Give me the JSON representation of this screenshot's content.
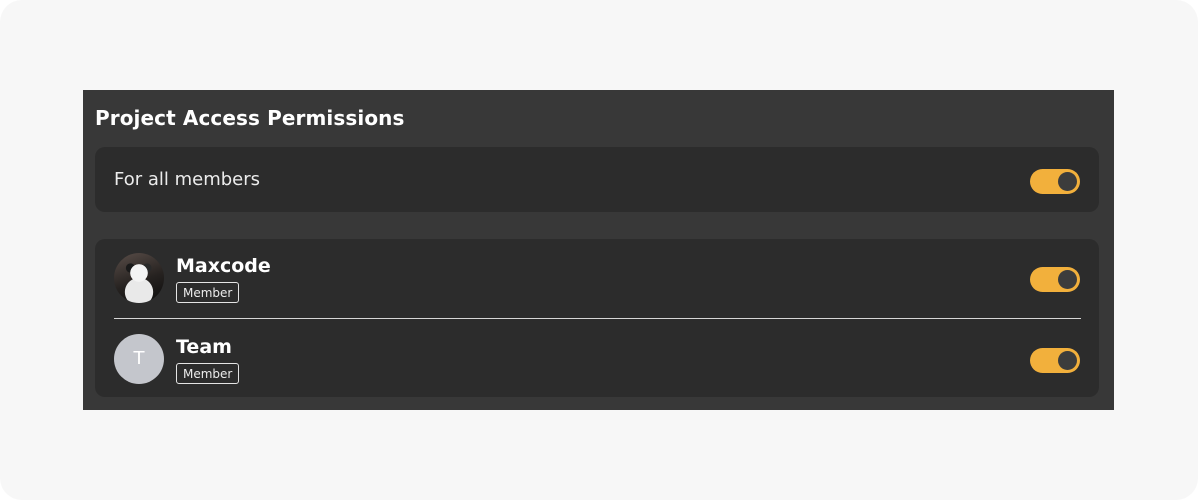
{
  "panel": {
    "title": "Project Access Permissions"
  },
  "all_members": {
    "label": "For all members",
    "toggle_on": true
  },
  "members": [
    {
      "name": "Maxcode",
      "role": "Member",
      "avatar": "photo",
      "toggle_on": true
    },
    {
      "name": "Team",
      "role": "Member",
      "avatar_initial": "T",
      "toggle_on": true
    }
  ],
  "colors": {
    "panel_bg": "#383838",
    "card_bg": "#2c2c2c",
    "toggle_on": "#f2b03c",
    "toggle_knob": "#3c3c3c",
    "avatar_placeholder": "#c4c6cc"
  },
  "icons": {
    "toggle": "toggle-switch-icon"
  }
}
